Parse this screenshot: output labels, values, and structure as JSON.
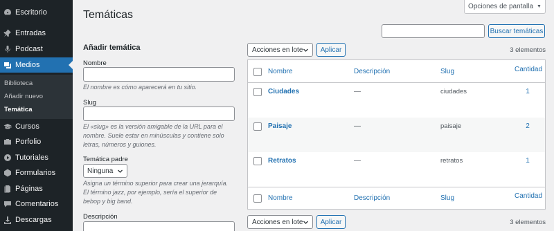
{
  "sidebar": {
    "items": [
      {
        "label": "Escritorio",
        "icon": "dashboard-icon"
      },
      {
        "label": "Entradas",
        "icon": "pin-icon"
      },
      {
        "label": "Podcast",
        "icon": "microphone-icon"
      },
      {
        "label": "Medios",
        "icon": "media-icon"
      },
      {
        "label": "Cursos",
        "icon": "graduation-cap-icon"
      },
      {
        "label": "Porfolio",
        "icon": "portfolio-icon"
      },
      {
        "label": "Tutoriales",
        "icon": "play-icon"
      },
      {
        "label": "Formularios",
        "icon": "forms-icon"
      },
      {
        "label": "Páginas",
        "icon": "pages-icon"
      },
      {
        "label": "Comentarios",
        "icon": "comments-icon"
      },
      {
        "label": "Descargas",
        "icon": "download-icon"
      }
    ],
    "submenu": [
      "Biblioteca",
      "Añadir nuevo",
      "Temática"
    ],
    "active_color": "#2271b1"
  },
  "header": {
    "title": "Temáticas",
    "screen_options": "Opciones de pantalla"
  },
  "search": {
    "placeholder": "",
    "button": "Buscar temáticas"
  },
  "form": {
    "heading": "Añadir temática",
    "name_label": "Nombre",
    "name_desc": "El nombre es cómo aparecerá en tu sitio.",
    "slug_label": "Slug",
    "slug_desc": "El «slug» es la versión amigable de la URL para el nombre. Suele estar en minúsculas y contiene solo letras, números y guiones.",
    "parent_label": "Temática padre",
    "parent_value": "Ninguna",
    "parent_desc": "Asigna un término superior para crear una jerarquía. El término jazz, por ejemplo, sería el superior de bebop y big band.",
    "description_label": "Descripción"
  },
  "bulk": {
    "select": "Acciones en lote",
    "apply": "Aplicar",
    "count": "3 elementos"
  },
  "table": {
    "columns": {
      "name": "Nombre",
      "description": "Descripción",
      "slug": "Slug",
      "count": "Cantidad"
    },
    "rows": [
      {
        "name": "Ciudades",
        "description": "—",
        "slug": "ciudades",
        "count": "1"
      },
      {
        "name": "Paisaje",
        "description": "—",
        "slug": "paisaje",
        "count": "2"
      },
      {
        "name": "Retratos",
        "description": "—",
        "slug": "retratos",
        "count": "1"
      }
    ]
  }
}
